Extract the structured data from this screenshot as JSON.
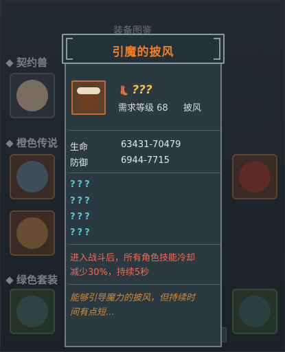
{
  "background": {
    "title": "装备图鉴",
    "sections": [
      "契约兽",
      "橙色传说",
      "绿色套装"
    ]
  },
  "popup": {
    "title": "引魔的披风",
    "item_name": "???",
    "boot_icon": "boot-icon",
    "requirement_label": "需求等级",
    "requirement_level": "68",
    "slot_type": "披风",
    "stats": [
      {
        "label": "生命",
        "value": "63431-70479"
      },
      {
        "label": "防御",
        "value": "6944-7715"
      }
    ],
    "unknown_affixes": [
      "???",
      "???",
      "???",
      "???"
    ],
    "effect_line1": "进入战斗后，所有角色技能冷却",
    "effect_line2": "减少30%，持续5秒",
    "desc_line1": "能够引导魔力的披风，但持续时",
    "desc_line2": "间有点短…"
  },
  "colors": {
    "title": "#f07f28",
    "item_name": "#f0c34c",
    "unknown": "#5cc7d6",
    "effect": "#f26a4e",
    "desc": "#d58a31"
  }
}
